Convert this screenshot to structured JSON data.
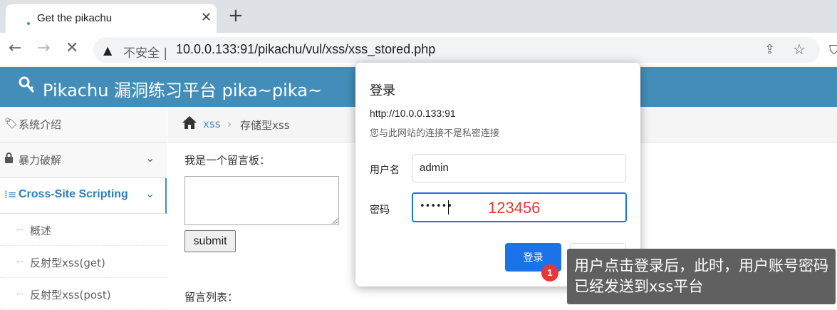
{
  "browser": {
    "tab_title": "Get the pikachu",
    "tab_close": "✕",
    "new_tab": "+",
    "security_label": "不安全",
    "url": "10.0.0.133:91/pikachu/vul/xss/xss_stored.php"
  },
  "header": {
    "brand": "Pikachu 漏洞练习平台 pika~pika~"
  },
  "sidebar": {
    "items": [
      {
        "label": "系统介绍"
      },
      {
        "label": "暴力破解"
      },
      {
        "label": "Cross-Site Scripting"
      }
    ],
    "subitems": [
      {
        "label": "概述"
      },
      {
        "label": "反射型xss(get)"
      },
      {
        "label": "反射型xss(post)"
      }
    ]
  },
  "breadcrumb": {
    "section": "xss",
    "page": "存储型xss"
  },
  "content": {
    "board_label": "我是一个留言板：",
    "submit_label": "submit",
    "list_label": "留言列表："
  },
  "dialog": {
    "title": "登录",
    "origin": "http://10.0.0.133:91",
    "warning": "您与此网站的连接不是私密连接",
    "username_label": "用户名",
    "username_value": "admin",
    "password_label": "密码",
    "password_masked": "••••••",
    "password_annotation": "123456",
    "login_label": "登录",
    "cancel_label": "取消"
  },
  "annotation": {
    "step": "1",
    "text": "用户点击登录后，此时，用户账号密码已经发送到xss平台"
  }
}
